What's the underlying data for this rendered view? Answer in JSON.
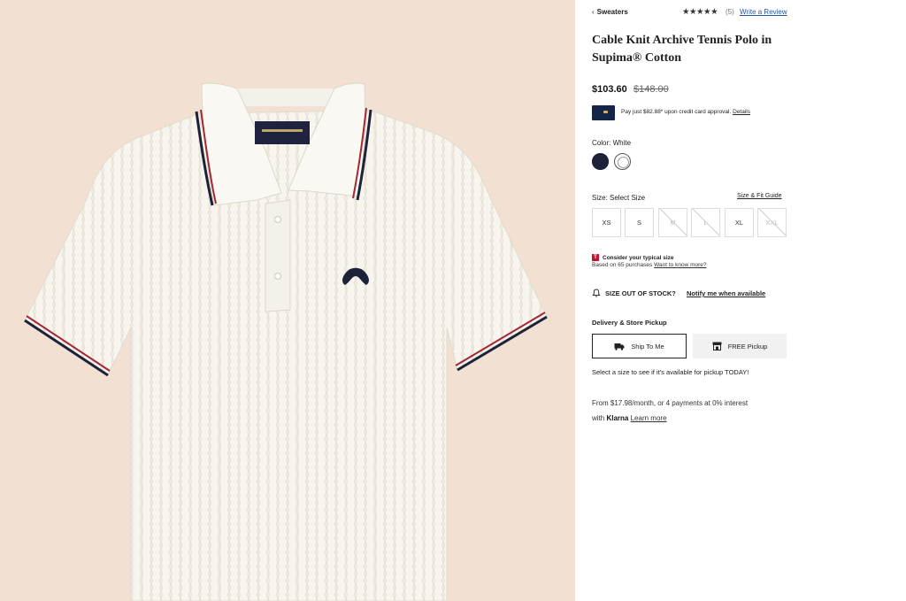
{
  "breadcrumb": {
    "chevron": "‹",
    "label": "Sweaters"
  },
  "rating": {
    "stars": "★★★★★",
    "count": "(5)",
    "write_review": "Write a Review"
  },
  "product": {
    "title": "Cable Knit Archive Tennis Polo in Supima® Cotton",
    "price": "$103.60",
    "original_price": "$148.00",
    "image_icon": "white-cable-knit-polo-shirt"
  },
  "card_offer": {
    "text": "Pay just $82.88* upon credit card approval.",
    "link": "Details",
    "icon": "credit-card-icon"
  },
  "color": {
    "label": "Color: White",
    "swatches": [
      "navy",
      "white"
    ],
    "selected": "white",
    "colors": {
      "navy": "#1d2238",
      "white": "#fafafa"
    }
  },
  "size": {
    "label": "Size: Select Size",
    "guide": "Size & Fit Guide",
    "options": [
      {
        "label": "XS",
        "available": true
      },
      {
        "label": "S",
        "available": true
      },
      {
        "label": "M",
        "available": false
      },
      {
        "label": "L",
        "available": false
      },
      {
        "label": "XL",
        "available": true
      },
      {
        "label": "XXL",
        "available": false
      }
    ]
  },
  "typical_size": {
    "badge": "T",
    "title": "Consider your typical size",
    "sub": "Based on 65 purchases",
    "link": "Want to know more?"
  },
  "stock": {
    "text": "SIZE OUT OF STOCK?",
    "link": "Notify me when available"
  },
  "delivery": {
    "label": "Delivery & Store Pickup",
    "ship": "Ship To Me",
    "pickup": "FREE Pickup",
    "message": "Select a size to see if it's available for pickup TODAY!"
  },
  "klarna": {
    "line1": "From $17.98/month, or 4 payments at 0% interest",
    "with": "with",
    "logo": "Klarna",
    "link": "Learn more"
  }
}
